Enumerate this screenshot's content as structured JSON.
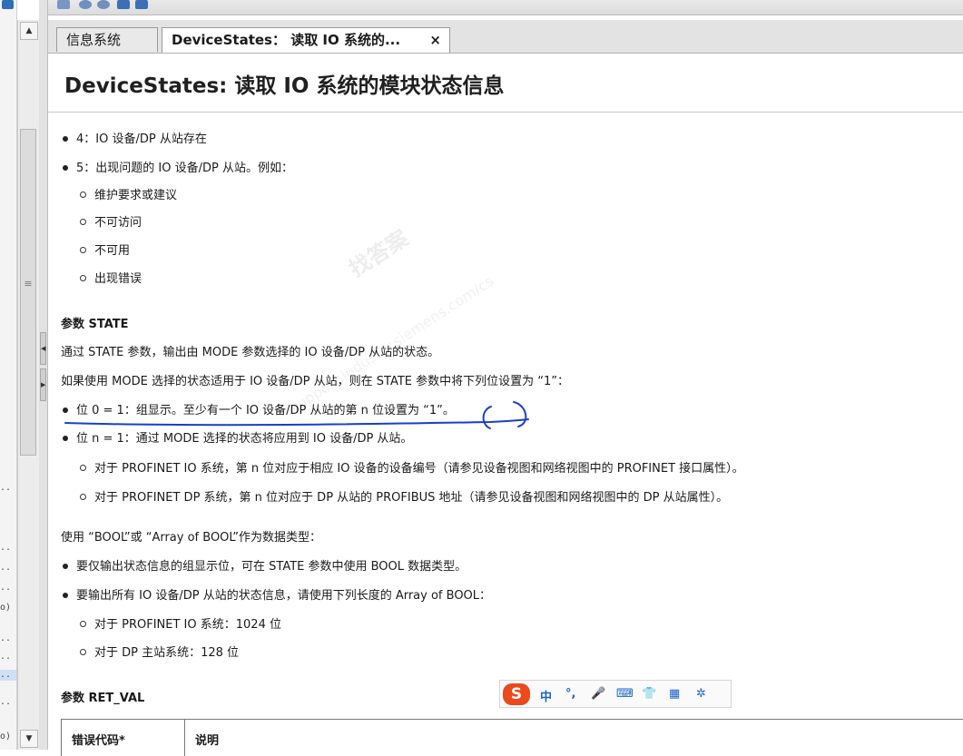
{
  "left_panel": {
    "labels": [
      "..",
      "..",
      "..",
      "..",
      "o)",
      "..",
      "..",
      "..",
      "..",
      "o)"
    ]
  },
  "tabs": {
    "info_label": "信息系统",
    "device_states_label": "DeviceStates： 读取 IO 系统的...",
    "close_symbol": "×"
  },
  "page": {
    "title": "DeviceStates:  读取 IO 系统的模块状态信息",
    "lines": [
      "4：IO 设备/DP 从站存在",
      "5：出现问题的 IO 设备/DP 从站。例如：",
      "维护要求或建议",
      "不可访问",
      "不可用",
      "出现错误",
      "参数 STATE",
      "通过 STATE 参数，输出由 MODE 参数选择的 IO 设备/DP 从站的状态。",
      "如果使用 MODE 选择的状态适用于 IO 设备/DP 从站，则在 STATE 参数中将下列位设置为 “1”：",
      "位 0 = 1：组显示。至少有一个 IO 设备/DP 从站的第 n 位设置为 “1”。",
      "位 n = 1：通过 MODE 选择的状态将应用到 IO 设备/DP 从站。",
      "对于 PROFINET IO 系统，第 n 位对应于相应 IO 设备的设备编号（请参见设备视图和网络视图中的 PROFINET 接口属性）。",
      "对于 PROFINET DP 系统，第 n 位对应于 DP 从站的 PROFIBUS 地址（请参见设备视图和网络视图中的 DP 从站属性）。",
      "使用 “BOOL”或 “Array of BOOL”作为数据类型：",
      "要仅输出状态信息的组显示位，可在 STATE 参数中使用 BOOL 数据类型。",
      "要输出所有 IO 设备/DP 从站的状态信息，请使用下列长度的 Array of BOOL：",
      "对于 PROFINET IO 系统：1024 位",
      "对于 DP 主站系统：128 位",
      "参数 RET_VAL"
    ],
    "table_headers": [
      "错误代码*",
      "说明"
    ]
  },
  "ime": {
    "logo": "S",
    "items": [
      "中",
      "°,",
      "🎤",
      "⌨",
      "👕",
      "▦",
      "✲"
    ]
  },
  "watermark": {
    "text_main": "找答案",
    "text_url": "support.industry.siemens.com/cs"
  },
  "colors": {
    "annotation": "#1a3fc8",
    "tab_active_bg": "#ffffff",
    "ime_accent": "#ea4a1c"
  }
}
